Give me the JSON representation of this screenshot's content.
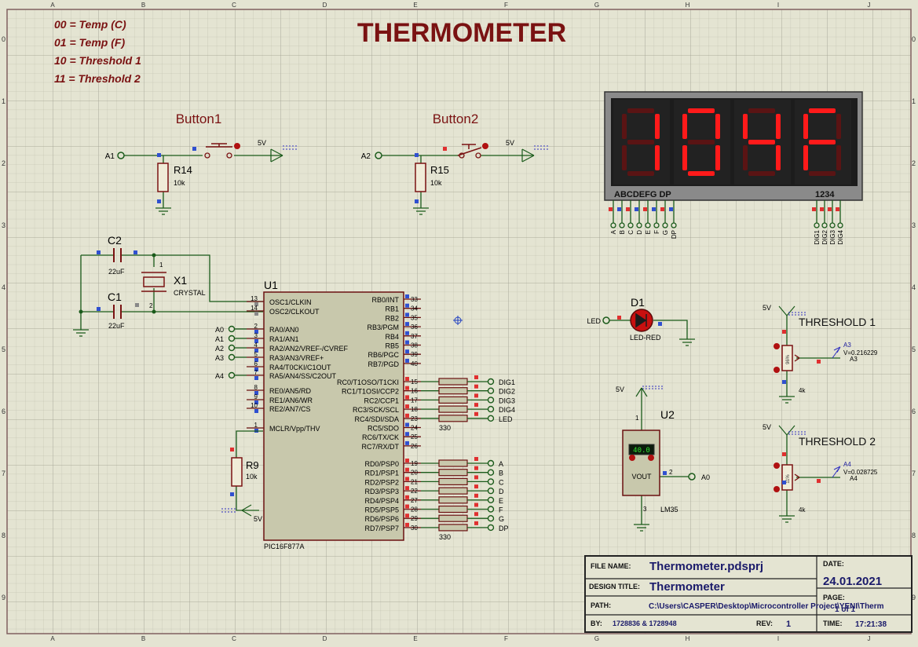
{
  "title": "THERMOMETER",
  "modes": [
    "00 = Temp (C)",
    "01 = Temp (F)",
    "10 = Threshold 1",
    "11 = Threshold 2"
  ],
  "border": {
    "cols": [
      "A",
      "B",
      "C",
      "D",
      "E",
      "F",
      "G",
      "H",
      "I",
      "J",
      "K"
    ],
    "rows": [
      "0",
      "1",
      "2",
      "3",
      "4",
      "5",
      "6",
      "7",
      "8",
      "9"
    ]
  },
  "buttons": [
    {
      "title": "Button1",
      "pin": "A1",
      "res": "R14",
      "res_val": "10k",
      "vcc": "5V"
    },
    {
      "title": "Button2",
      "pin": "A2",
      "res": "R15",
      "res_val": "10k",
      "vcc": "5V"
    }
  ],
  "display": {
    "digits": [
      "1",
      "0",
      "4",
      "F"
    ],
    "seg_label": "ABCDEFG DP",
    "dig_label": "1234",
    "seg_pins": [
      "A",
      "B",
      "C",
      "D",
      "E",
      "F",
      "G",
      "DP"
    ],
    "dig_pins": [
      "DIG1",
      "DIG2",
      "DIG3",
      "DIG4"
    ]
  },
  "osc": {
    "c2": "C2",
    "c1": "C1",
    "cval": "22uF",
    "x1": "X1",
    "x1_type": "CRYSTAL",
    "x1_p1": "1",
    "x1_p2": "2"
  },
  "mcu": {
    "ref": "U1",
    "part": "PIC16F877A",
    "left_pins": [
      {
        "num": "13",
        "name": "OSC1/CLKIN",
        "net": ""
      },
      {
        "num": "14",
        "name": "OSC2/CLKOUT",
        "net": ""
      },
      {
        "num": "2",
        "name": "RA0/AN0",
        "net": "A0"
      },
      {
        "num": "3",
        "name": "RA1/AN1",
        "net": "A1"
      },
      {
        "num": "4",
        "name": "RA2/AN2/VREF-/CVREF",
        "net": "A2"
      },
      {
        "num": "5",
        "name": "RA3/AN3/VREF+",
        "net": "A3"
      },
      {
        "num": "6",
        "name": "RA4/T0CKI/C1OUT",
        "net": ""
      },
      {
        "num": "7",
        "name": "RA5/AN4/SS/C2OUT",
        "net": "A4"
      },
      {
        "num": "8",
        "name": "RE0/AN5/RD",
        "net": ""
      },
      {
        "num": "9",
        "name": "RE1/AN6/WR",
        "net": ""
      },
      {
        "num": "10",
        "name": "RE2/AN7/CS",
        "net": ""
      },
      {
        "num": "1",
        "name": "MCLR/Vpp/THV",
        "net": ""
      }
    ],
    "right_pins": [
      {
        "num": "33",
        "name": "RB0/INT"
      },
      {
        "num": "34",
        "name": "RB1"
      },
      {
        "num": "35",
        "name": "RB2"
      },
      {
        "num": "36",
        "name": "RB3/PGM"
      },
      {
        "num": "37",
        "name": "RB4"
      },
      {
        "num": "38",
        "name": "RB5"
      },
      {
        "num": "39",
        "name": "RB6/PGC"
      },
      {
        "num": "40",
        "name": "RB7/PGD"
      },
      {
        "num": "15",
        "name": "RC0/T1OSO/T1CKI"
      },
      {
        "num": "16",
        "name": "RC1/T1OSI/CCP2"
      },
      {
        "num": "17",
        "name": "RC2/CCP1"
      },
      {
        "num": "18",
        "name": "RC3/SCK/SCL"
      },
      {
        "num": "23",
        "name": "RC4/SDI/SDA"
      },
      {
        "num": "24",
        "name": "RC5/SDO"
      },
      {
        "num": "25",
        "name": "RC6/TX/CK"
      },
      {
        "num": "26",
        "name": "RC7/RX/DT"
      },
      {
        "num": "19",
        "name": "RD0/PSP0"
      },
      {
        "num": "20",
        "name": "RD1/PSP1"
      },
      {
        "num": "21",
        "name": "RD2/PSP2"
      },
      {
        "num": "22",
        "name": "RD3/PSP3"
      },
      {
        "num": "27",
        "name": "RD4/PSP4"
      },
      {
        "num": "28",
        "name": "RD5/PSP5"
      },
      {
        "num": "29",
        "name": "RD6/PSP6"
      },
      {
        "num": "30",
        "name": "RD7/PSP7"
      }
    ]
  },
  "rc_nets": [
    "DIG1",
    "DIG2",
    "DIG3",
    "DIG4",
    "LED"
  ],
  "rd_nets": [
    "A",
    "B",
    "C",
    "D",
    "E",
    "F",
    "G",
    "DP"
  ],
  "pack_val": "330",
  "r9": {
    "ref": "R9",
    "val": "10k",
    "vcc": "5V"
  },
  "led": {
    "ref": "D1",
    "type": "LED-RED",
    "net": "LED"
  },
  "lm35": {
    "ref": "U2",
    "part": "LM35",
    "reading": "40.0",
    "vout": "VOUT",
    "pin1": "1",
    "pin2": "2",
    "pin3": "3",
    "net": "A0",
    "vcc": "5V"
  },
  "thresholds": [
    {
      "title": "THRESHOLD 1",
      "net": "A3",
      "volt": "V=0.216229",
      "res": "4k",
      "pct": "96%",
      "vcc": "5V"
    },
    {
      "title": "THRESHOLD 2",
      "net": "A4",
      "volt": "V=0.028725",
      "res": "4k",
      "pct": "11%",
      "vcc": "5V"
    }
  ],
  "titleblock": {
    "file_label": "FILE NAME:",
    "file": "Thermometer.pdsprj",
    "design_label": "DESIGN TITLE:",
    "design": "Thermometer",
    "path_label": "PATH:",
    "path": "C:\\Users\\CASPER\\Desktop\\Microcontroller Project\\YENI\\Therm",
    "by_label": "BY:",
    "by": "1728836 & 1728948",
    "rev_label": "REV:",
    "rev": "1",
    "date_label": "DATE:",
    "date": "24.01.2021",
    "page_label": "PAGE:",
    "page": "1 of 1",
    "time_label": "TIME:",
    "time": "17:21:38"
  }
}
